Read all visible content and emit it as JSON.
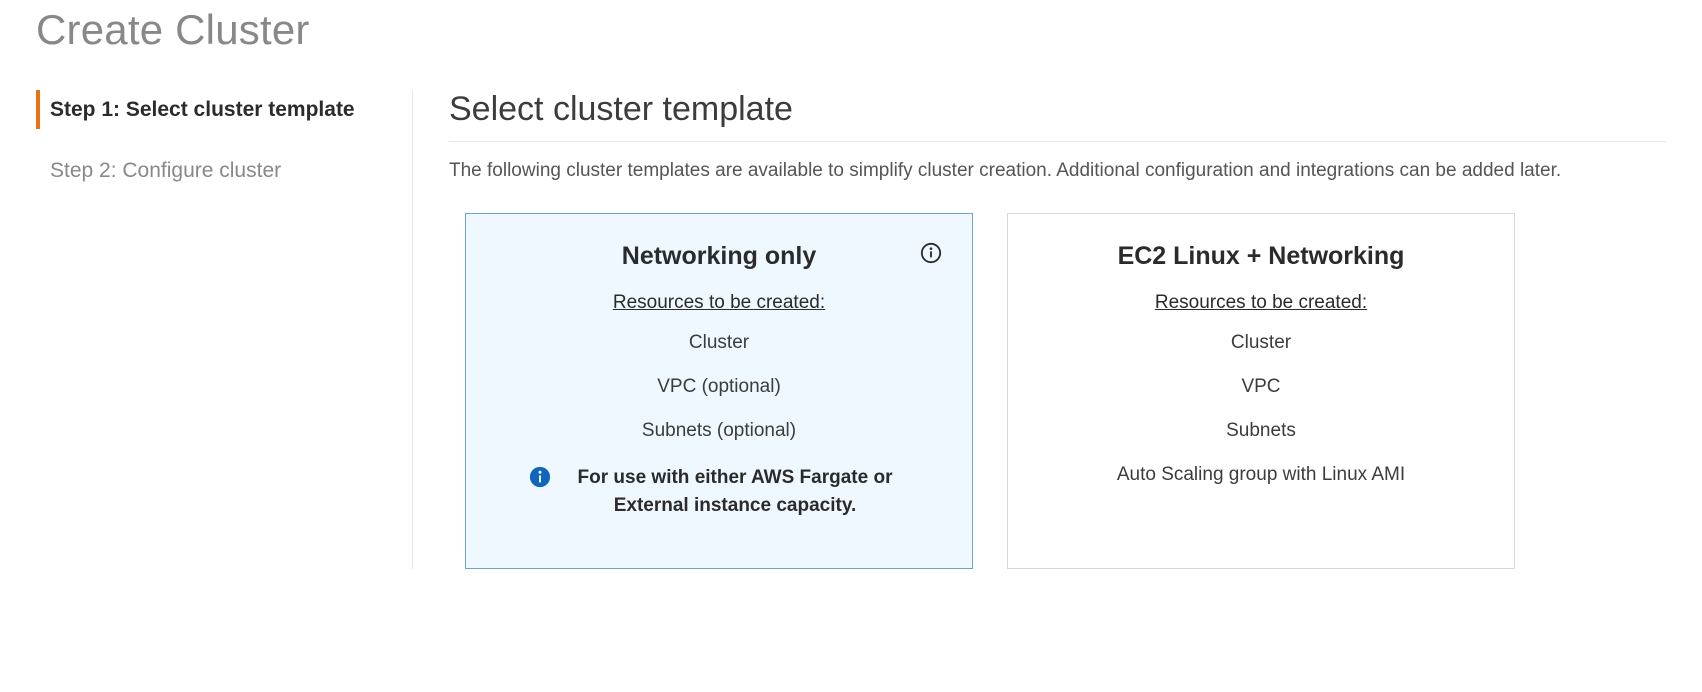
{
  "header": {
    "title": "Create Cluster"
  },
  "steps": [
    {
      "label": "Step 1: Select cluster template",
      "active": true
    },
    {
      "label": "Step 2: Configure cluster",
      "active": false
    }
  ],
  "main": {
    "section_title": "Select cluster template",
    "section_desc": "The following cluster templates are available to simplify cluster creation. Additional configuration and integrations can be added later.",
    "cards": [
      {
        "title": "Networking only",
        "selected": true,
        "has_info": true,
        "resources_label": "Resources to be created:",
        "resources": [
          "Cluster",
          "VPC (optional)",
          "Subnets (optional)"
        ],
        "note": "For use with either AWS Fargate or External instance capacity."
      },
      {
        "title": "EC2 Linux + Networking",
        "selected": false,
        "has_info": false,
        "resources_label": "Resources to be created:",
        "resources": [
          "Cluster",
          "VPC",
          "Subnets",
          "Auto Scaling group with Linux AMI"
        ],
        "note": ""
      }
    ]
  },
  "icons": {
    "info": "info-icon"
  }
}
